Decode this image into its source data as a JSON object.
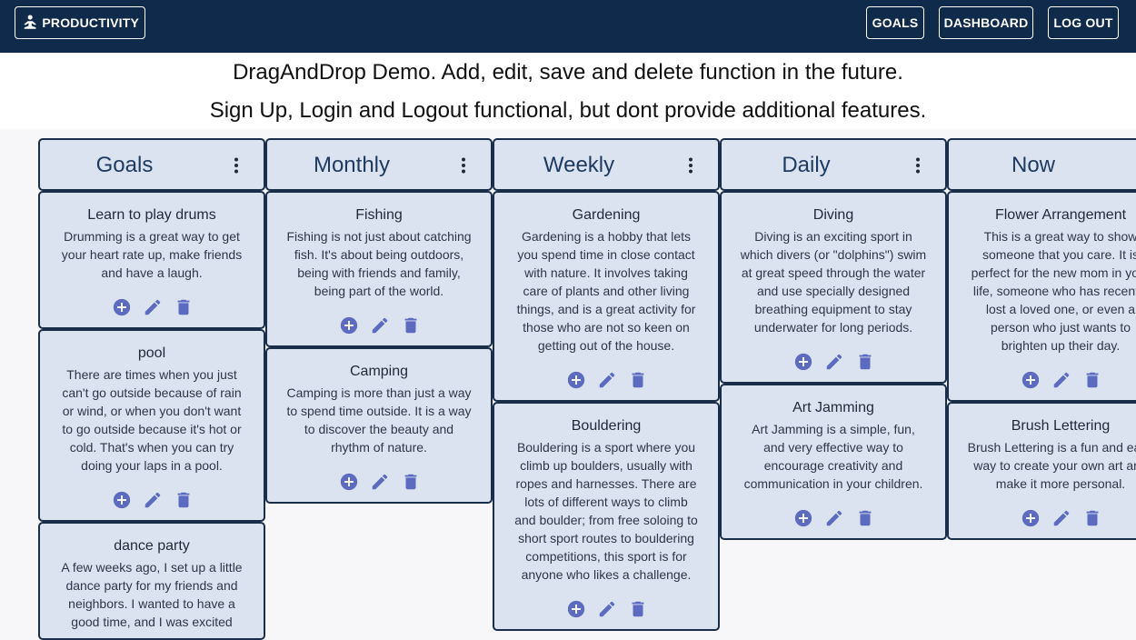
{
  "nav": {
    "brand": "PRODUCTIVITY",
    "goals": "GOALS",
    "dashboard": "DASHBOARD",
    "logout": "LOG OUT"
  },
  "intro": {
    "line1": "DragAndDrop Demo. Add, edit, save and delete function in the future.",
    "line2": "Sign Up, Login and Logout functional, but dont provide additional features."
  },
  "colors": {
    "topbar": "#102a4c",
    "card_bg": "#dbe3f1",
    "card_border": "#1a2e4a",
    "icon_accent": "#5c6bc0"
  },
  "columns": [
    {
      "title": "Goals",
      "cards": [
        {
          "title": "Learn to play drums",
          "description": "Drumming is a great way to get your heart rate up, make friends and have a laugh."
        },
        {
          "title": "pool",
          "description": "There are times when you just can't go outside because of rain or wind, or when you don't want to go outside because it's hot or cold. That's when you can try doing your laps in a pool."
        },
        {
          "title": "dance party",
          "description": "A few weeks ago, I set up a little dance party for my friends and neighbors. I wanted to have a good time, and I was excited"
        }
      ]
    },
    {
      "title": "Monthly",
      "cards": [
        {
          "title": "Fishing",
          "description": "Fishing is not just about catching fish. It's about being outdoors, being with friends and family, being part of the world."
        },
        {
          "title": "Camping",
          "description": "Camping is more than just a way to spend time outside. It is a way to discover the beauty and rhythm of nature."
        }
      ]
    },
    {
      "title": "Weekly",
      "cards": [
        {
          "title": "Gardening",
          "description": "Gardening is a hobby that lets you spend time in close contact with nature. It involves taking care of plants and other living things, and is a great activity for those who are not so keen on getting out of the house."
        },
        {
          "title": "Bouldering",
          "description": "Bouldering is a sport where you climb up boulders, usually with ropes and harnesses. There are lots of different ways to climb and boulder; from free soloing to short sport routes to bouldering competitions, this sport is for anyone who likes a challenge."
        }
      ]
    },
    {
      "title": "Daily",
      "cards": [
        {
          "title": "Diving",
          "description": "Diving is an exciting sport in which divers (or \"dolphins\") swim at great speed through the water and use specially designed breathing equipment to stay underwater for long periods."
        },
        {
          "title": "Art Jamming",
          "description": "Art Jamming is a simple, fun, and very effective way to encourage creativity and communication in your children."
        }
      ]
    },
    {
      "title": "Now",
      "cards": [
        {
          "title": "Flower Arrangement",
          "description": "This is a great way to show someone that you care. It is perfect for the new mom in your life, someone who has recently lost a loved one, or even a person who just wants to brighten up their day."
        },
        {
          "title": "Brush Lettering",
          "description": "Brush Lettering is a fun and easy way to create your own art and make it more personal."
        }
      ]
    }
  ]
}
